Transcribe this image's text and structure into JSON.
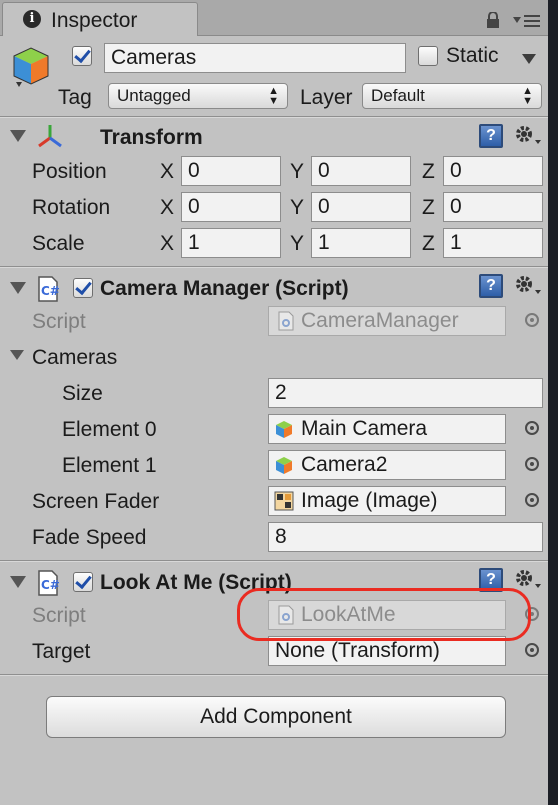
{
  "tab": {
    "label": "Inspector"
  },
  "header": {
    "object_name": "Cameras",
    "static_label": "Static",
    "tag_label": "Tag",
    "tag_value": "Untagged",
    "layer_label": "Layer",
    "layer_value": "Default"
  },
  "transform": {
    "title": "Transform",
    "rows": [
      {
        "label": "Position",
        "x": "0",
        "y": "0",
        "z": "0"
      },
      {
        "label": "Rotation",
        "x": "0",
        "y": "0",
        "z": "0"
      },
      {
        "label": "Scale",
        "x": "1",
        "y": "1",
        "z": "1"
      }
    ],
    "axis_x": "X",
    "axis_y": "Y",
    "axis_z": "Z"
  },
  "camera_manager": {
    "title": "Camera Manager (Script)",
    "script_label": "Script",
    "script_value": "CameraManager",
    "cameras_label": "Cameras",
    "size_label": "Size",
    "size_value": "2",
    "element0_label": "Element 0",
    "element0_value": "Main Camera",
    "element1_label": "Element 1",
    "element1_value": "Camera2",
    "screen_fader_label": "Screen Fader",
    "screen_fader_value": "Image (Image)",
    "fade_speed_label": "Fade Speed",
    "fade_speed_value": "8"
  },
  "look_at_me": {
    "title": "Look At Me (Script)",
    "script_label": "Script",
    "script_value": "LookAtMe",
    "target_label": "Target",
    "target_value": "None (Transform)"
  },
  "add_component_label": "Add Component",
  "colors": {
    "panel_bg": "#c2c2c2",
    "highlight_ring": "#ea2b21",
    "check": "#1f4ea8"
  }
}
